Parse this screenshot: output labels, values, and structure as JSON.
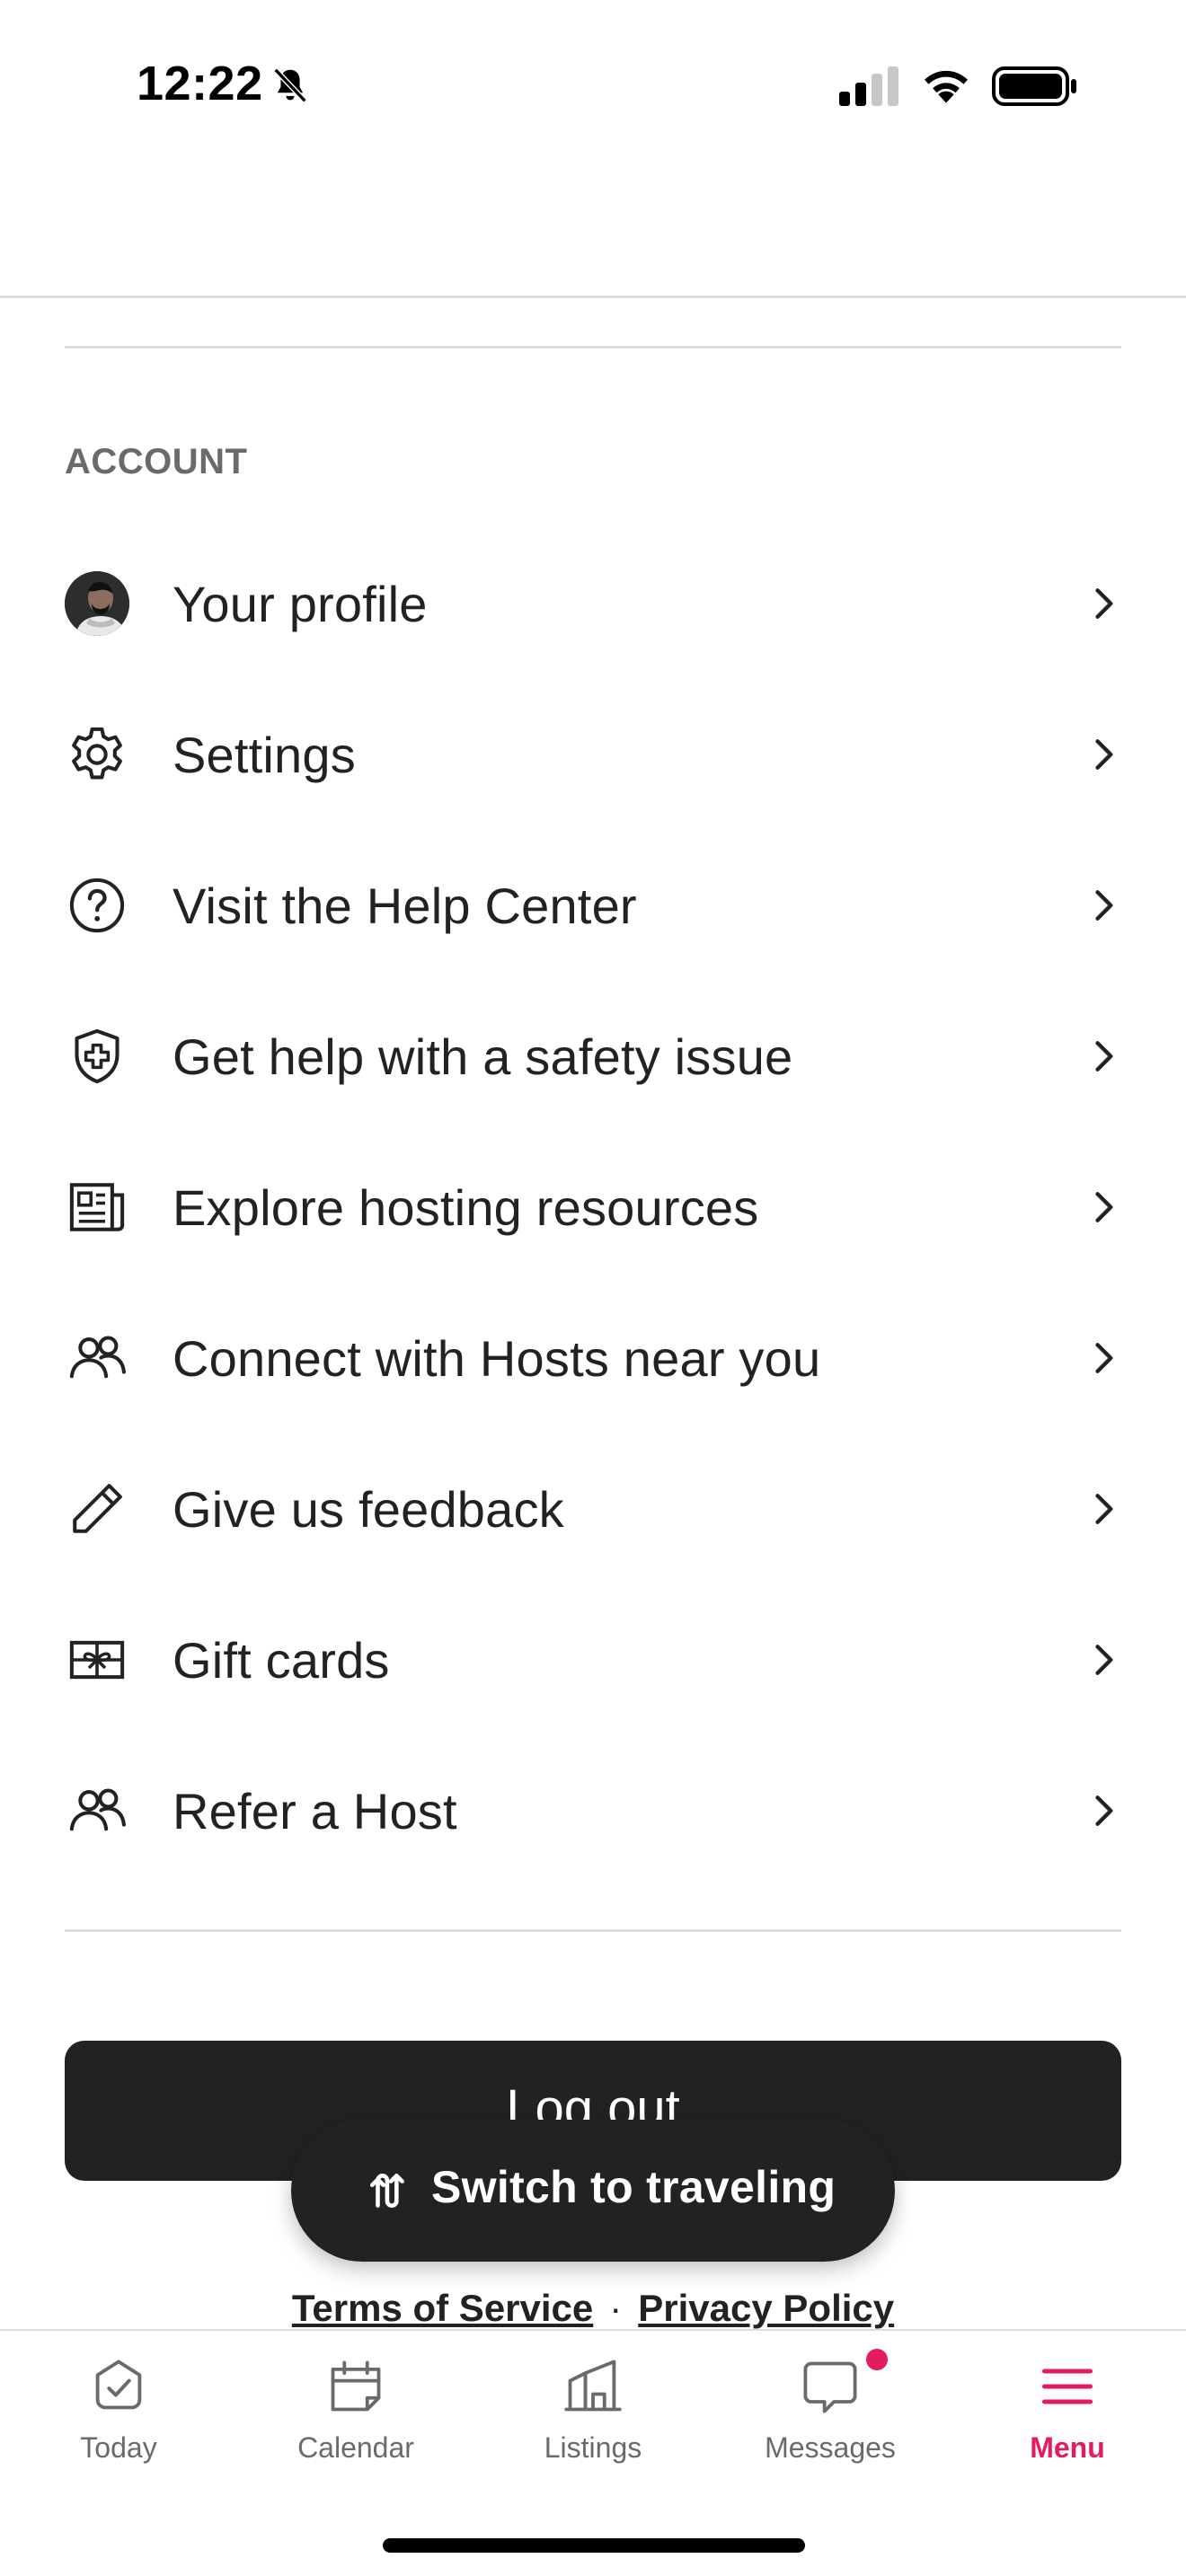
{
  "status_bar": {
    "time": "12:22",
    "icons": [
      "bell-slash-icon",
      "signal-icon",
      "wifi-icon",
      "battery-icon"
    ]
  },
  "account": {
    "section_title": "ACCOUNT",
    "items": [
      {
        "label": "Your profile",
        "icon": "avatar"
      },
      {
        "label": "Settings",
        "icon": "gear-icon"
      },
      {
        "label": "Visit the Help Center",
        "icon": "question-circle-icon"
      },
      {
        "label": "Get help with a safety issue",
        "icon": "shield-plus-icon"
      },
      {
        "label": "Explore hosting resources",
        "icon": "newspaper-icon"
      },
      {
        "label": "Connect with Hosts near you",
        "icon": "people-icon"
      },
      {
        "label": "Give us feedback",
        "icon": "pencil-icon"
      },
      {
        "label": "Gift cards",
        "icon": "gift-card-icon"
      },
      {
        "label": "Refer a Host",
        "icon": "people-icon"
      }
    ]
  },
  "actions": {
    "logout_label": "Log out",
    "switch_label": "Switch to traveling"
  },
  "legal": {
    "terms": "Terms of Service",
    "separator": "·",
    "privacy": "Privacy Policy"
  },
  "tabs": [
    {
      "label": "Today",
      "icon": "check-badge-icon",
      "active": false
    },
    {
      "label": "Calendar",
      "icon": "calendar-icon",
      "active": false
    },
    {
      "label": "Listings",
      "icon": "building-icon",
      "active": false
    },
    {
      "label": "Messages",
      "icon": "chat-bubble-icon",
      "active": false,
      "badge": true
    },
    {
      "label": "Menu",
      "icon": "hamburger-icon",
      "active": true
    }
  ],
  "colors": {
    "accent": "#E31C5F",
    "text": "#222222",
    "muted": "#6A6A6A",
    "divider": "#DDDDDD",
    "button_dark": "#222222"
  }
}
